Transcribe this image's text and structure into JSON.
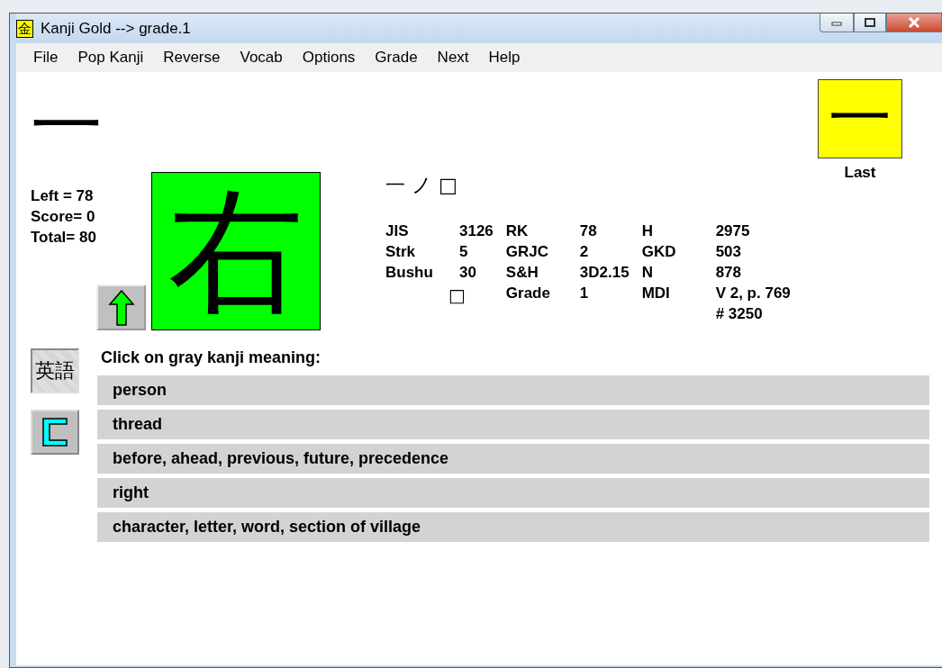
{
  "window": {
    "app_icon": "金",
    "title": "Kanji Gold --> grade.1"
  },
  "menu": [
    {
      "label": "File"
    },
    {
      "label": "Pop Kanji"
    },
    {
      "label": "Reverse"
    },
    {
      "label": "Vocab"
    },
    {
      "label": "Options"
    },
    {
      "label": "Grade"
    },
    {
      "label": "Next"
    },
    {
      "label": "Help"
    }
  ],
  "previous_kanji": "一",
  "last_box": {
    "kanji": "一",
    "label": "Last"
  },
  "stats": [
    "Left = 78",
    "Score= 0",
    "Total= 80"
  ],
  "current_kanji": "右",
  "components": "一 ノ □",
  "info_columns": [
    {
      "pairs": [
        {
          "label": "JIS",
          "value": "3126"
        },
        {
          "label": "Strk",
          "value": "5"
        },
        {
          "label": "Bushu",
          "value": "30"
        }
      ],
      "note": "□"
    },
    {
      "pairs": [
        {
          "label": "RK",
          "value": "78"
        },
        {
          "label": "GRJC",
          "value": "2"
        },
        {
          "label": "S&H",
          "value": "3D2.15"
        },
        {
          "label": "Grade",
          "value": "1"
        }
      ]
    },
    {
      "pairs": [
        {
          "label": "H",
          "value": "2975"
        },
        {
          "label": "GKD",
          "value": "503"
        },
        {
          "label": "N",
          "value": "878"
        },
        {
          "label": "MDI",
          "value": "V 2, p. 769"
        },
        {
          "value": "# 3250"
        }
      ]
    }
  ],
  "mode_buttons": [
    {
      "kind": "text",
      "label": "英語",
      "selected": true
    },
    {
      "kind": "icon",
      "selected": false
    }
  ],
  "prompt": "Click on gray kanji meaning:",
  "choices": [
    "person",
    "thread",
    "before, ahead, previous, future, precedence",
    "right",
    "character, letter, word, section of village"
  ]
}
